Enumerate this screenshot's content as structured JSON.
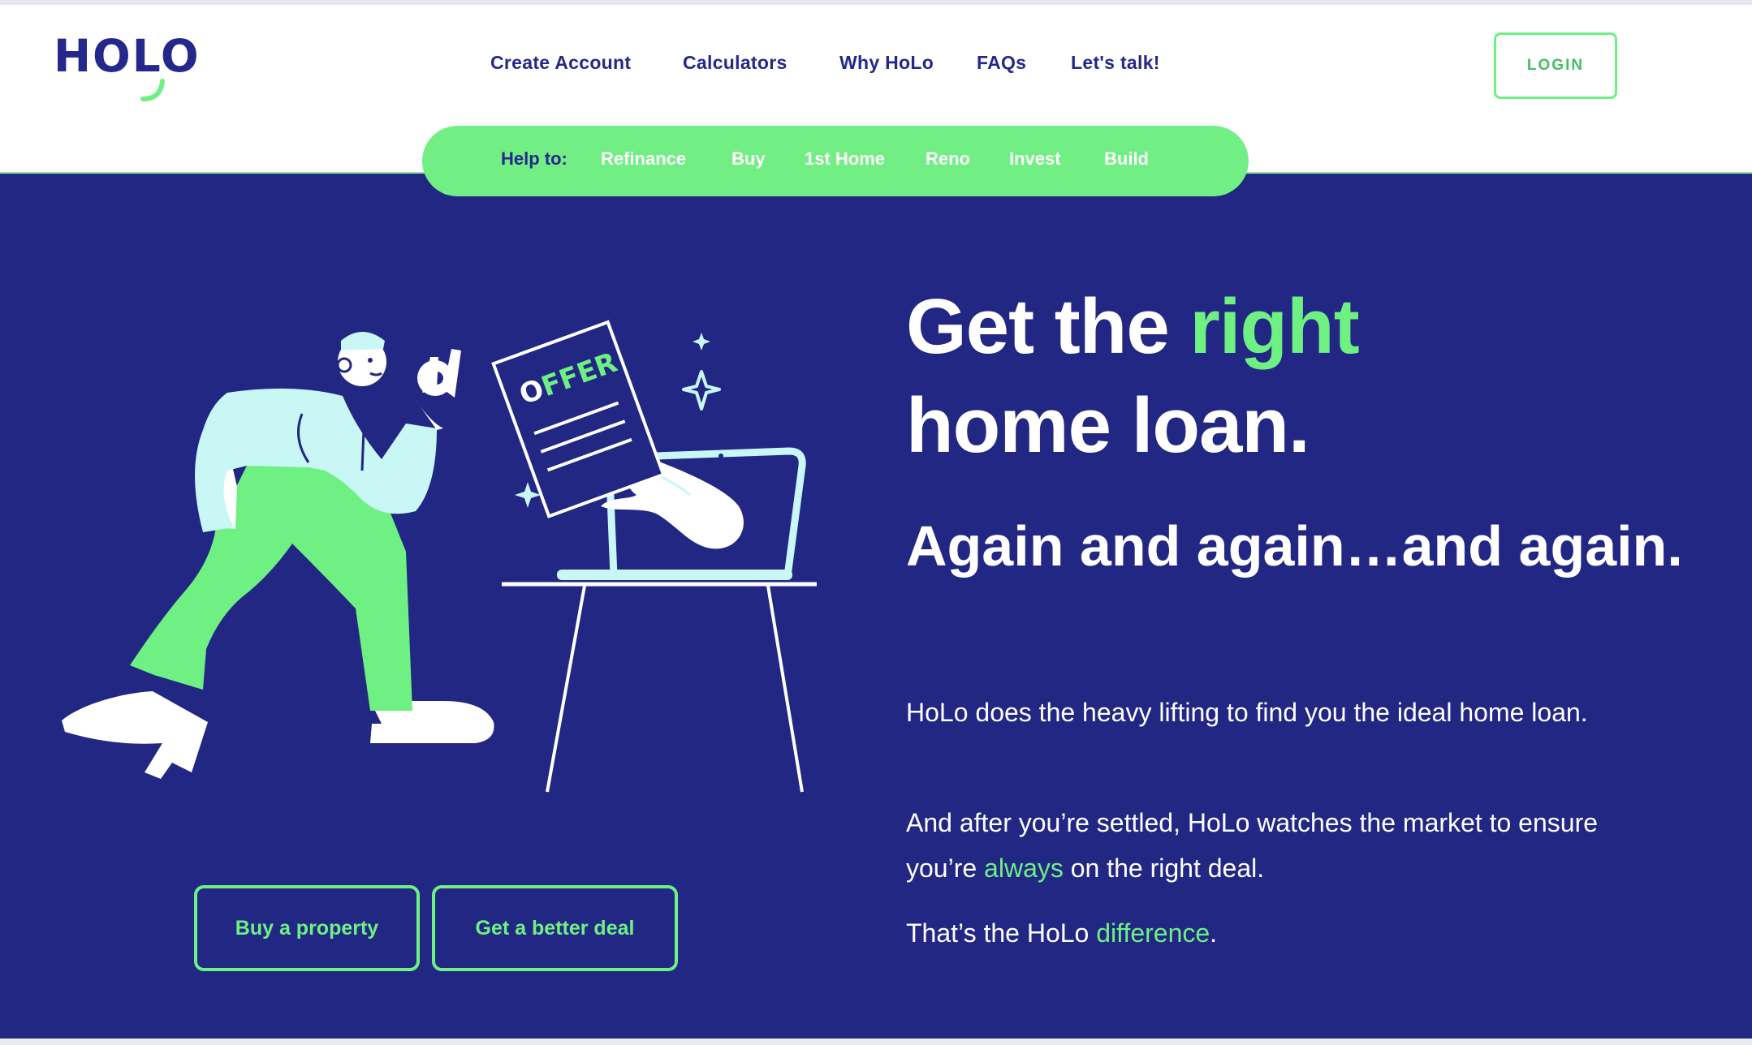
{
  "brand": {
    "logo_text": "HOLO",
    "colors": {
      "navy": "#222784",
      "green": "#6ef083",
      "light_blue": "#c8f7f6",
      "white": "#ffffff"
    }
  },
  "nav": {
    "items": [
      "Create Account",
      "Calculators",
      "Why HoLo",
      "FAQs",
      "Let's talk!"
    ],
    "login_label": "LOGIN"
  },
  "subnav": {
    "label": "Help to:",
    "links": [
      "Refinance",
      "Buy",
      "1st Home",
      "Reno",
      "Invest",
      "Build"
    ]
  },
  "hero": {
    "heading_part1": "Get the ",
    "heading_highlight": "right",
    "heading_part2": "home loan.",
    "subheading": "Again and again…and again.",
    "para1": "HoLo does the heavy lifting to find you the ideal home loan.",
    "para2_before": "And after you’re settled, HoLo watches the market to ensure you’re ",
    "para2_highlight": "always",
    "para2_after": " on the right deal.",
    "para3_before": "That’s the HoLo ",
    "para3_highlight": "difference",
    "para3_after": ".",
    "buttons": [
      "Buy a property",
      "Get a better deal"
    ],
    "illustration": {
      "offer_text": "OFFER",
      "icons": [
        "person-illustration",
        "offer-document",
        "laptop",
        "desk",
        "sparkle-icon"
      ]
    }
  }
}
